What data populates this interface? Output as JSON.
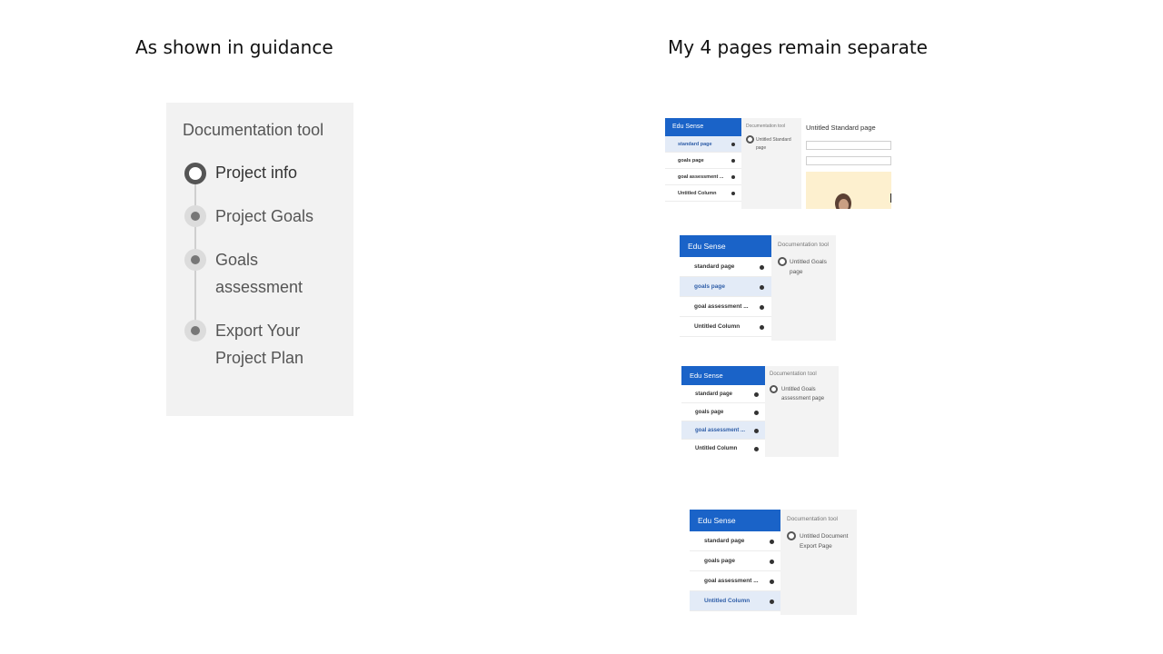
{
  "headings": {
    "left": "As shown in guidance",
    "right": "My 4 pages remain separate"
  },
  "guidance": {
    "title": "Documentation tool",
    "steps": [
      {
        "label": "Project info",
        "state": "active"
      },
      {
        "label": "Project Goals",
        "state": "idle"
      },
      {
        "label": "Goals assessment",
        "state": "idle"
      },
      {
        "label": "Export Your Project Plan",
        "state": "idle"
      }
    ]
  },
  "screenshots": [
    {
      "brand": "Edu Sense",
      "nav": [
        "standard page",
        "goals page",
        "goal assessment ...",
        "Untitled Column"
      ],
      "selected": 0,
      "doc_title": "Documentation tool",
      "page_name": "Untitled Standard page",
      "content_title": "Untitled Standard page"
    },
    {
      "brand": "Edu Sense",
      "nav": [
        "standard page",
        "goals page",
        "goal assessment ...",
        "Untitled Column"
      ],
      "selected": 1,
      "doc_title": "Documentation tool",
      "page_name": "Untitled Goals page"
    },
    {
      "brand": "Edu Sense",
      "nav": [
        "standard page",
        "goals page",
        "goal assessment ...",
        "Untitled Column"
      ],
      "selected": 2,
      "doc_title": "Documentation tool",
      "page_name": "Untitled Goals assessment page"
    },
    {
      "brand": "Edu Sense",
      "nav": [
        "standard page",
        "goals page",
        "goal assessment ...",
        "Untitled Column"
      ],
      "selected": 3,
      "doc_title": "Documentation tool",
      "page_name": "Untitled Document Export Page"
    }
  ],
  "colors": {
    "brand_blue": "#1a63c8",
    "selected_nav_bg": "#e3ebf7",
    "selected_nav_text": "#2f5ea8",
    "panel_bg": "#f2f2f2"
  }
}
